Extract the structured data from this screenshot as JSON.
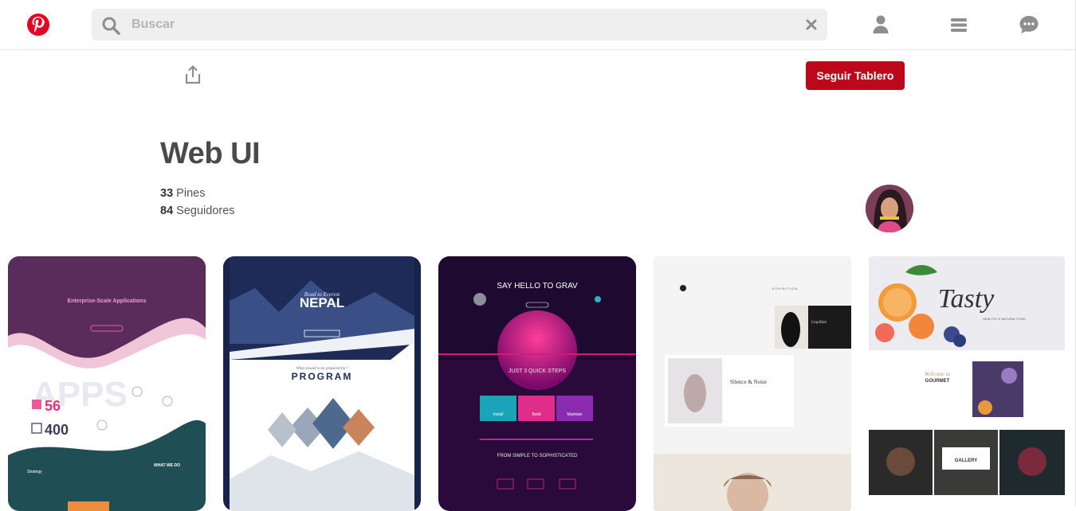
{
  "header": {
    "search_placeholder": "Buscar"
  },
  "board": {
    "follow_label": "Seguir Tablero",
    "title": "Web UI",
    "pins_count": "33",
    "pins_label": "Pines",
    "followers_count": "84",
    "followers_label": "Seguidores"
  },
  "pins": [
    {
      "kind": "apps-landing",
      "headline": "Enterprise-Scale Applications",
      "watermark": "APPS",
      "stat1": "56",
      "stat2": "400",
      "section_left": "Strategy",
      "section_right": "WHAT WE DO"
    },
    {
      "kind": "travel-landing",
      "tagline": "Road to Everest",
      "headline": "NEPAL",
      "subtitle": "What should to be prepared for?",
      "section": "PROGRAM"
    },
    {
      "kind": "grav-landing",
      "headline": "SAY HELLO TO GRAV",
      "steps_title": "JUST 3 QUICK STEPS",
      "step1": "Install",
      "step2": "Build",
      "step3": "Maintain",
      "bottom": "FROM SIMPLE TO SOPHISTICATED"
    },
    {
      "kind": "exhibition-landing",
      "label": "EXHIBITION",
      "feature": "Silence & Noise",
      "side": "Liquified"
    },
    {
      "kind": "restaurant-landing",
      "brand": "Tasty",
      "tagline": "HEALTHY & NATURAL FOOD",
      "welcome": "Welcome to",
      "name": "GOURMET",
      "gallery": "GALLERY"
    }
  ],
  "colors": {
    "brand_red": "#bd081c",
    "pinterest_red": "#e60023",
    "search_bg": "#efefef",
    "icon_gray": "#8e8e8e"
  }
}
